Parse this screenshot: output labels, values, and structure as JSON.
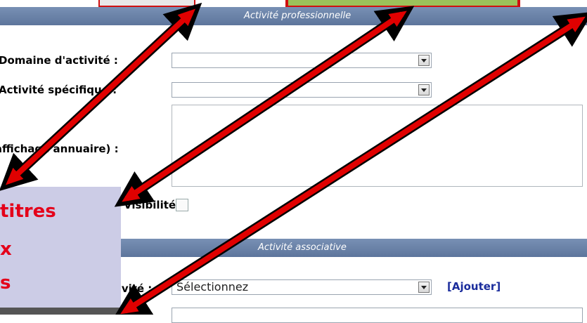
{
  "sections": {
    "professional": "Activité professionnelle",
    "associative": "Activité associative"
  },
  "form": {
    "domain_label": "Domaine d'activité :",
    "specific_label": "Activité spécifique :",
    "annuaire_label": "(affichage annuaire) :",
    "check_label": "Visibilité :",
    "assoc_label": "Activité :",
    "assoc_select_value": "Sélectionnez",
    "add_link": "[Ajouter]"
  },
  "callout": {
    "line1": "titres",
    "line2": "x",
    "line3": "s"
  },
  "colors": {
    "section_bar": "#6b83a8",
    "arrow_red": "#e00000",
    "callout_bg": "#cccce6",
    "callout_text": "#e4001a",
    "link": "#1a2c9c",
    "top_green": "#9bc25a"
  }
}
